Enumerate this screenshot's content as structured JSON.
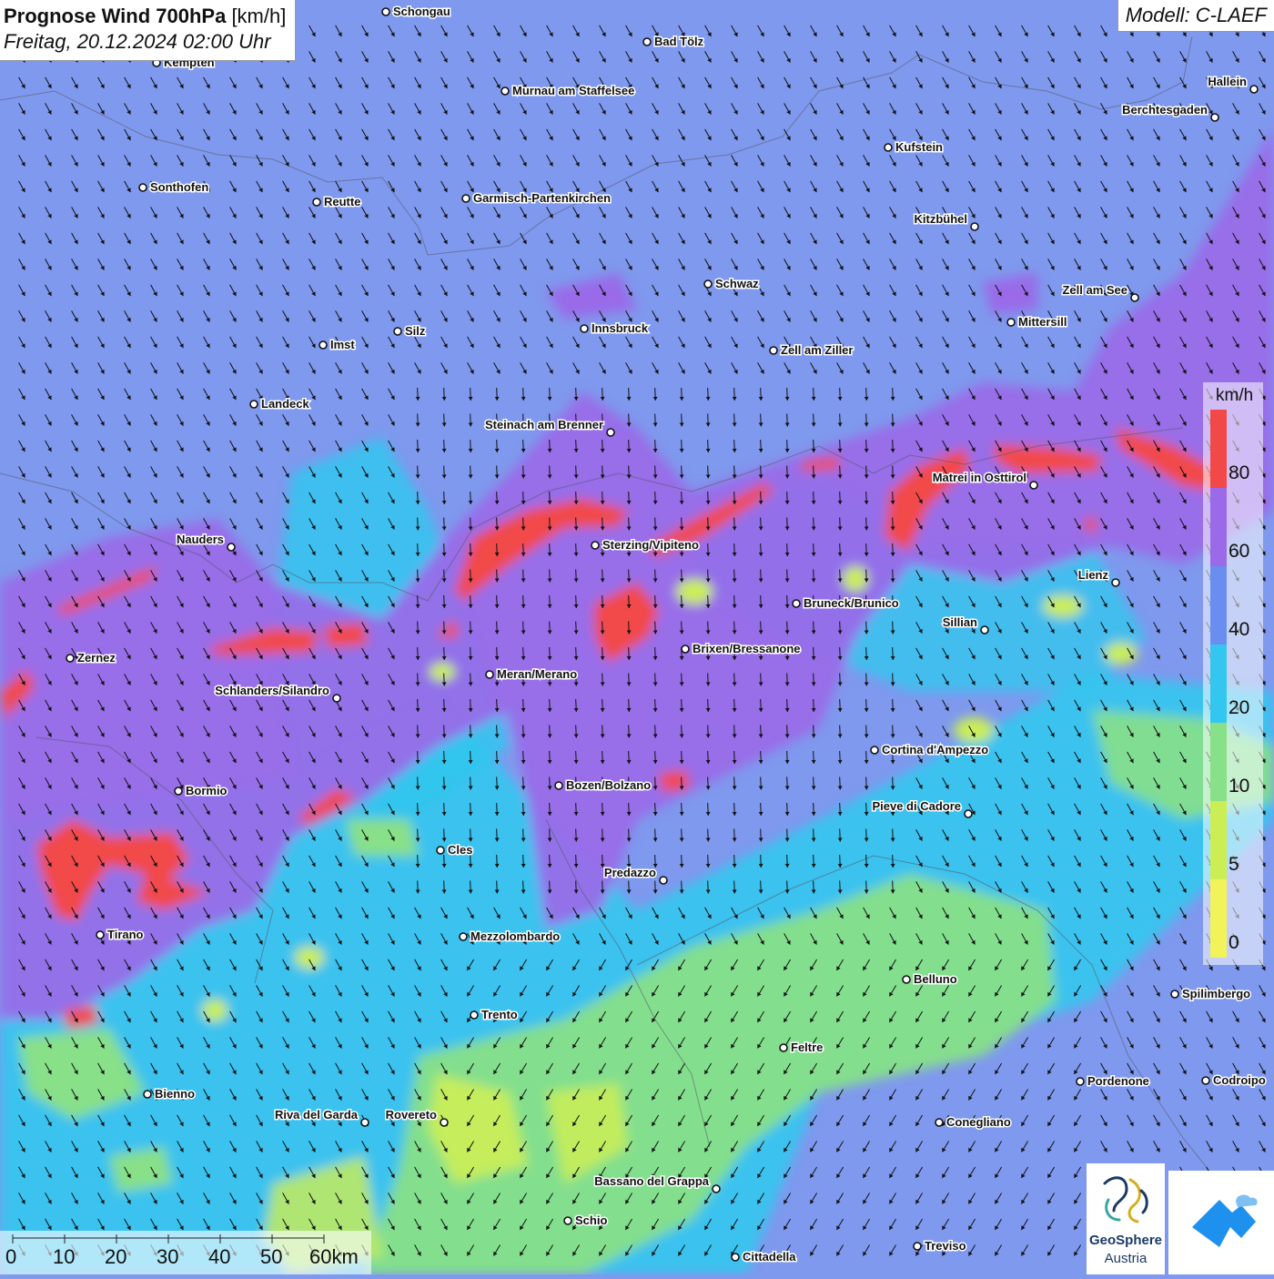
{
  "title": {
    "main": "Prognose Wind 700hPa",
    "unit": "[km/h]",
    "datetime": "Freitag, 20.12.2024 02:00 Uhr"
  },
  "model": "Modell: C-LAEF",
  "legend": {
    "unit": "km/h",
    "ticks": [
      "80",
      "60",
      "40",
      "20",
      "10",
      "5",
      "0"
    ],
    "colors": [
      "#f24848",
      "#9a6ae8",
      "#6a8ef0",
      "#33c6ee",
      "#88e088",
      "#ccee55",
      "#f2f25a"
    ]
  },
  "scale_bar": {
    "labels": [
      "0",
      "10",
      "20",
      "30",
      "40",
      "50",
      "60km"
    ]
  },
  "logos": {
    "geosphere_line1": "GeoSphere",
    "geosphere_line2": "Austria"
  },
  "cities": [
    {
      "name": "Schongau",
      "side": "right"
    },
    {
      "name": "Bad Tölz",
      "side": "right"
    },
    {
      "name": "Kempten",
      "side": "right"
    },
    {
      "name": "Murnau am Staffelsee",
      "side": "right"
    },
    {
      "name": "Hallein",
      "side": "left"
    },
    {
      "name": "Berchtesgaden",
      "side": "left"
    },
    {
      "name": "Kufstein",
      "side": "right"
    },
    {
      "name": "Sonthofen",
      "side": "right"
    },
    {
      "name": "Reutte",
      "side": "right"
    },
    {
      "name": "Garmisch-Partenkirchen",
      "side": "right"
    },
    {
      "name": "Kitzbühel",
      "side": "left"
    },
    {
      "name": "Schwaz",
      "side": "right"
    },
    {
      "name": "Zell am See",
      "side": "left"
    },
    {
      "name": "Innsbruck",
      "side": "right"
    },
    {
      "name": "Silz",
      "side": "right"
    },
    {
      "name": "Mittersill",
      "side": "right"
    },
    {
      "name": "Imst",
      "side": "right"
    },
    {
      "name": "Zell am Ziller",
      "side": "right"
    },
    {
      "name": "Landeck",
      "side": "right"
    },
    {
      "name": "Steinach am Brenner",
      "side": "left"
    },
    {
      "name": "Matrei in Osttirol",
      "side": "left"
    },
    {
      "name": "Nauders",
      "side": "left"
    },
    {
      "name": "Sterzing/Vipiteno",
      "side": "right"
    },
    {
      "name": "Lienz",
      "side": "left"
    },
    {
      "name": "Bruneck/Brunico",
      "side": "right"
    },
    {
      "name": "Sillian",
      "side": "left"
    },
    {
      "name": "Zernez",
      "side": "right"
    },
    {
      "name": "Brixen/Bressanone",
      "side": "right"
    },
    {
      "name": "Meran/Merano",
      "side": "right"
    },
    {
      "name": "Schlanders/Silandro",
      "side": "left"
    },
    {
      "name": "Cortina d'Ampezzo",
      "side": "right"
    },
    {
      "name": "Bozen/Bolzano",
      "side": "right"
    },
    {
      "name": "Bormio",
      "side": "right"
    },
    {
      "name": "Pieve di Cadore",
      "side": "left"
    },
    {
      "name": "Cles",
      "side": "right"
    },
    {
      "name": "Predazzo",
      "side": "left"
    },
    {
      "name": "Tirano",
      "side": "right"
    },
    {
      "name": "Mezzolombardo",
      "side": "right"
    },
    {
      "name": "Belluno",
      "side": "right"
    },
    {
      "name": "Spilimbergo",
      "side": "right"
    },
    {
      "name": "Trento",
      "side": "right"
    },
    {
      "name": "Feltre",
      "side": "right"
    },
    {
      "name": "Pordenone",
      "side": "right"
    },
    {
      "name": "Codroipo",
      "side": "right"
    },
    {
      "name": "Bienno",
      "side": "right"
    },
    {
      "name": "Riva del Garda",
      "side": "left"
    },
    {
      "name": "Rovereto",
      "side": "left"
    },
    {
      "name": "Conegliano",
      "side": "right"
    },
    {
      "name": "Bassano del Grappa",
      "side": "left"
    },
    {
      "name": "Schio",
      "side": "right"
    },
    {
      "name": "Treviso",
      "side": "right"
    },
    {
      "name": "Cittadella",
      "side": "right"
    }
  ]
}
